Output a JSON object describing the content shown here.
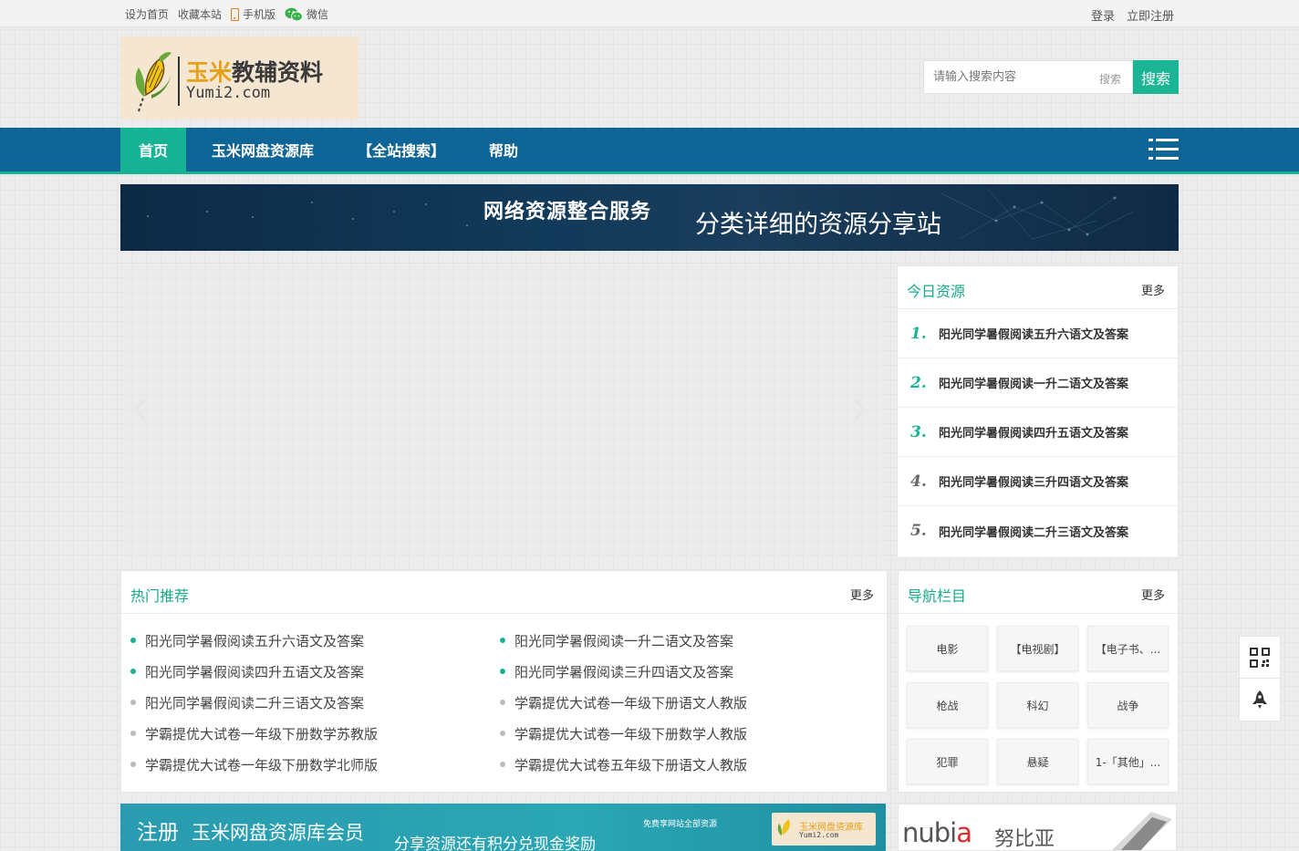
{
  "topbar": {
    "set_home": "设为首页",
    "bookmark": "收藏本站",
    "mobile": "手机版",
    "wechat": "微信",
    "login": "登录",
    "register": "立即注册"
  },
  "logo": {
    "cn_part1": "玉米",
    "cn_part2": "教辅资料",
    "en": "Yumi2.com"
  },
  "search": {
    "placeholder": "请输入搜索内容",
    "hint": "搜索",
    "button": "搜索"
  },
  "nav": {
    "items": [
      "首页",
      "玉米网盘资源库",
      "【全站搜索】",
      "帮助"
    ],
    "active_index": 0
  },
  "banner": {
    "title1": "网络资源整合服务",
    "title2": "分类详细的资源分享站"
  },
  "today": {
    "title": "今日资源",
    "more": "更多",
    "items": [
      {
        "num": "1.",
        "text": "阳光同学暑假阅读五升六语文及答案",
        "color": "#17b294"
      },
      {
        "num": "2.",
        "text": "阳光同学暑假阅读一升二语文及答案",
        "color": "#17b294"
      },
      {
        "num": "3.",
        "text": "阳光同学暑假阅读四升五语文及答案",
        "color": "#17b294"
      },
      {
        "num": "4.",
        "text": "阳光同学暑假阅读三升四语文及答案",
        "color": "#666666"
      },
      {
        "num": "5.",
        "text": "阳光同学暑假阅读二升三语文及答案",
        "color": "#666666"
      }
    ]
  },
  "hot": {
    "title": "热门推荐",
    "more": "更多",
    "items": [
      {
        "text": "阳光同学暑假阅读五升六语文及答案",
        "hot": true
      },
      {
        "text": "阳光同学暑假阅读一升二语文及答案",
        "hot": true
      },
      {
        "text": "阳光同学暑假阅读四升五语文及答案",
        "hot": true
      },
      {
        "text": "阳光同学暑假阅读三升四语文及答案",
        "hot": true
      },
      {
        "text": "阳光同学暑假阅读二升三语文及答案",
        "hot": false
      },
      {
        "text": "学霸提优大试卷一年级下册语文人教版",
        "hot": false
      },
      {
        "text": "学霸提优大试卷一年级下册数学苏教版",
        "hot": false
      },
      {
        "text": "学霸提优大试卷一年级下册数学人教版",
        "hot": false
      },
      {
        "text": "学霸提优大试卷一年级下册数学北师版",
        "hot": false
      },
      {
        "text": "学霸提优大试卷五年级下册语文人教版",
        "hot": false
      }
    ]
  },
  "navcol": {
    "title": "导航栏目",
    "more": "更多",
    "items": [
      "电影",
      "【电视剧】",
      "【电子书、...",
      "枪战",
      "科幻",
      "战争",
      "犯罪",
      "悬疑",
      "1-「其他」..."
    ]
  },
  "ad1": {
    "register": "注册",
    "member": "玉米网盘资源库会员",
    "reward": "分享资源还有积分兑现金奖励",
    "small": "免费享网站全部资源",
    "box_title": "玉米网盘资源库",
    "box_en": "Yumi2.com"
  },
  "ad2": {
    "brand": "nubia",
    "brand_cn": "努比亚"
  },
  "colors": {
    "accent": "#17b294",
    "nav_bg": "#0f6595"
  },
  "icons": {
    "qr": "qr-code-icon",
    "rocket": "rocket-icon",
    "menu": "hamburger-menu-icon",
    "phone": "phone-icon",
    "wechat": "wechat-icon"
  }
}
